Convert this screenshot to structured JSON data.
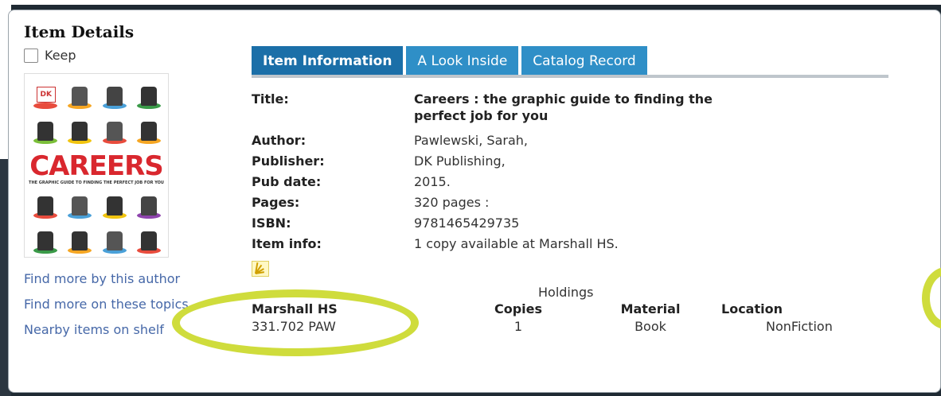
{
  "dialog": {
    "title": "Item Details",
    "keep_label": "Keep",
    "keep_checked": false
  },
  "cover": {
    "word": "CAREERS",
    "subtitle": "THE GRAPHIC GUIDE TO FINDING THE PERFECT JOB FOR YOU",
    "publisher_logo": "DK"
  },
  "side_links": [
    {
      "label": "Find more by this author"
    },
    {
      "label": "Find more on these topics"
    },
    {
      "label": "Nearby items on shelf"
    }
  ],
  "tabs": [
    {
      "label": "Item Information",
      "active": true
    },
    {
      "label": "A Look Inside",
      "active": false
    },
    {
      "label": "Catalog Record",
      "active": false
    }
  ],
  "details": {
    "title_label": "Title:",
    "title_value": "Careers : the graphic guide to finding the perfect job for you",
    "author_label": "Author:",
    "author_value": "Pawlewski, Sarah,",
    "publisher_label": "Publisher:",
    "publisher_value": "DK Publishing,",
    "pubdate_label": "Pub date:",
    "pubdate_value": "2015.",
    "pages_label": "Pages:",
    "pages_value": "320 pages :",
    "isbn_label": "ISBN:",
    "isbn_value": "9781465429735",
    "iteminfo_label": "Item info:",
    "iteminfo_value": "1 copy available at Marshall HS."
  },
  "holdings": {
    "heading": "Holdings",
    "columns": [
      "Marshall HS",
      "Copies",
      "Material",
      "Location"
    ],
    "row": {
      "call_number": "331.702 PAW",
      "copies": "1",
      "material": "Book",
      "location": "NonFiction"
    }
  },
  "colors": {
    "tab_active": "#1b6fa8",
    "tab": "#2f8fc7",
    "link": "#4668a8",
    "highlight_ring": "#cfdc3c"
  },
  "icons": {
    "rss": "rss-feed-icon"
  }
}
